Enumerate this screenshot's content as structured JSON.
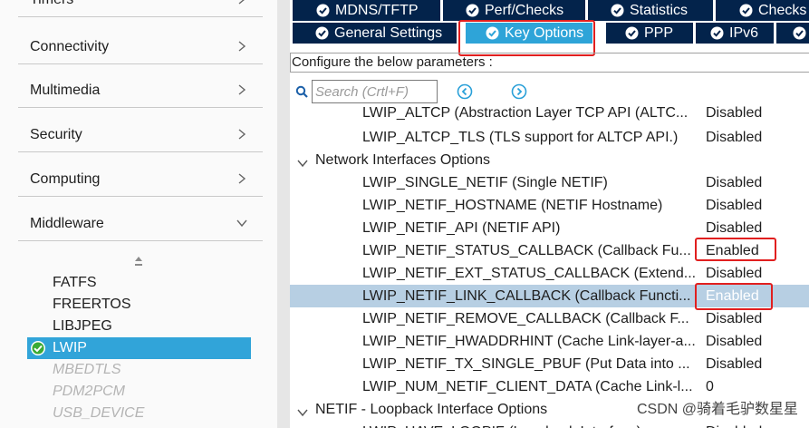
{
  "left_panel": {
    "categories": [
      {
        "label": "Timers",
        "expanded": false
      },
      {
        "label": "Connectivity",
        "expanded": false
      },
      {
        "label": "Multimedia",
        "expanded": false
      },
      {
        "label": "Security",
        "expanded": false
      },
      {
        "label": "Computing",
        "expanded": false
      },
      {
        "label": "Middleware",
        "expanded": true
      }
    ],
    "middleware_items": [
      {
        "label": "FATFS",
        "state": "normal"
      },
      {
        "label": "FREERTOS",
        "state": "normal"
      },
      {
        "label": "LIBJPEG",
        "state": "normal"
      },
      {
        "label": "LWIP",
        "state": "selected",
        "icon": "check-circle-icon"
      },
      {
        "label": "MBEDTLS",
        "state": "disabled"
      },
      {
        "label": "PDM2PCM",
        "state": "disabled"
      },
      {
        "label": "USB_DEVICE",
        "state": "disabled"
      }
    ]
  },
  "tabs": {
    "row1": [
      {
        "label": "MDNS/TFTP",
        "icon": "check-circle-icon"
      },
      {
        "label": "Perf/Checks",
        "icon": "check-circle-icon"
      },
      {
        "label": "Statistics",
        "icon": "check-circle-icon"
      },
      {
        "label": "Checks",
        "icon": "check-circle-icon"
      }
    ],
    "row2": [
      {
        "label": "General Settings",
        "icon": "check-circle-icon"
      },
      {
        "label": "Key Options",
        "icon": "check-circle-icon",
        "active": true
      },
      {
        "label": "PPP",
        "icon": "check-circle-icon"
      },
      {
        "label": "IPv6",
        "icon": "check-circle-icon"
      },
      {
        "label": "",
        "icon": "check-circle-icon"
      }
    ]
  },
  "config": {
    "label": "Configure the below parameters :",
    "search_placeholder": "Search (Crtl+F)"
  },
  "tree": [
    {
      "type": "param",
      "name": "LWIP_ALTCP (Abstraction Layer TCP API (ALTC...",
      "value": "Disabled"
    },
    {
      "type": "param",
      "name": "LWIP_ALTCP_TLS (TLS support for ALTCP API.)",
      "value": "Disabled"
    },
    {
      "type": "group",
      "name": "Network Interfaces Options"
    },
    {
      "type": "param",
      "name": "LWIP_SINGLE_NETIF (Single NETIF)",
      "value": "Disabled"
    },
    {
      "type": "param",
      "name": "LWIP_NETIF_HOSTNAME (NETIF Hostname)",
      "value": "Disabled"
    },
    {
      "type": "param",
      "name": "LWIP_NETIF_API (NETIF API)",
      "value": "Disabled"
    },
    {
      "type": "param",
      "name": "LWIP_NETIF_STATUS_CALLBACK (Callback Fu...",
      "value": "Enabled"
    },
    {
      "type": "param",
      "name": "LWIP_NETIF_EXT_STATUS_CALLBACK (Extend...",
      "value": "Disabled"
    },
    {
      "type": "param",
      "name": "LWIP_NETIF_LINK_CALLBACK (Callback Functi...",
      "value": "Enabled",
      "selected": true
    },
    {
      "type": "param",
      "name": "LWIP_NETIF_REMOVE_CALLBACK (Callback F...",
      "value": "Disabled"
    },
    {
      "type": "param",
      "name": "LWIP_NETIF_HWADDRHINT (Cache Link-layer-a...",
      "value": "Disabled"
    },
    {
      "type": "param",
      "name": "LWIP_NETIF_TX_SINGLE_PBUF (Put Data into ...",
      "value": "Disabled"
    },
    {
      "type": "param",
      "name": "LWIP_NUM_NETIF_CLIENT_DATA (Cache Link-l...",
      "value": "0"
    },
    {
      "type": "group",
      "name": "NETIF - Loopback Interface Options"
    },
    {
      "type": "param",
      "name": "LWIP_HAVE_LOOPIF (Loopback Interface)",
      "value": "Disabled"
    }
  ],
  "watermark": "CSDN @骑着毛驴数星星",
  "colors": {
    "tab_bg": "#03234b",
    "tab_active": "#2ea4d8",
    "selected_item": "#31a4d9",
    "selected_row": "#b7cfe3",
    "highlight_box": "#e11f1f"
  }
}
